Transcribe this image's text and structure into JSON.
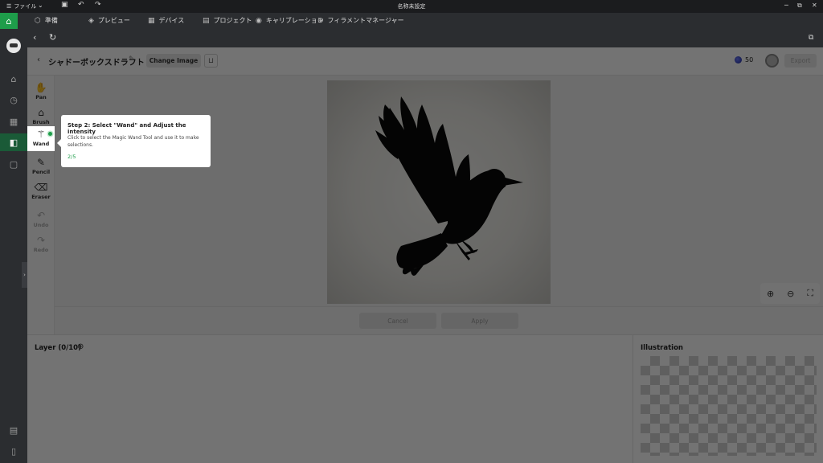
{
  "titlebar": {
    "menu_label": "ファイル",
    "window_title": "名称未設定"
  },
  "nav": {
    "tabs": [
      {
        "label": "準備",
        "icon": "cube-icon"
      },
      {
        "label": "プレビュー",
        "icon": "layers-icon"
      },
      {
        "label": "デバイス",
        "icon": "device-icon"
      },
      {
        "label": "プロジェクト",
        "icon": "project-icon"
      },
      {
        "label": "キャリブレーション",
        "icon": "calibration-icon"
      },
      {
        "label": "フィラメントマネージャー",
        "icon": "filament-icon"
      }
    ]
  },
  "editor": {
    "title": "シャドーボックスドラフト",
    "change_image": "Change Image",
    "credits": "50",
    "export": "Export"
  },
  "tools": [
    {
      "label": "Pan",
      "icon": "hand-icon"
    },
    {
      "label": "Brush",
      "icon": "brush-icon"
    },
    {
      "label": "Wand",
      "icon": "wand-icon"
    },
    {
      "label": "Pencil",
      "icon": "pencil-icon"
    },
    {
      "label": "Eraser",
      "icon": "eraser-icon"
    },
    {
      "label": "Undo",
      "icon": "undo-icon"
    },
    {
      "label": "Redo",
      "icon": "redo-icon"
    }
  ],
  "tooltip": {
    "heading": "Step 2: Select \"Wand\" and Adjust the intensity",
    "body": "Click to select the Magic Wand Tool and use it to make selections.",
    "step": "2/5"
  },
  "actions": {
    "cancel": "Cancel",
    "apply": "Apply"
  },
  "panels": {
    "layer_title": "Layer (0/10)",
    "illustration_title": "Illustration"
  },
  "colors": {
    "accent": "#1e9d4a",
    "sidebar_active": "#1a5a37"
  }
}
